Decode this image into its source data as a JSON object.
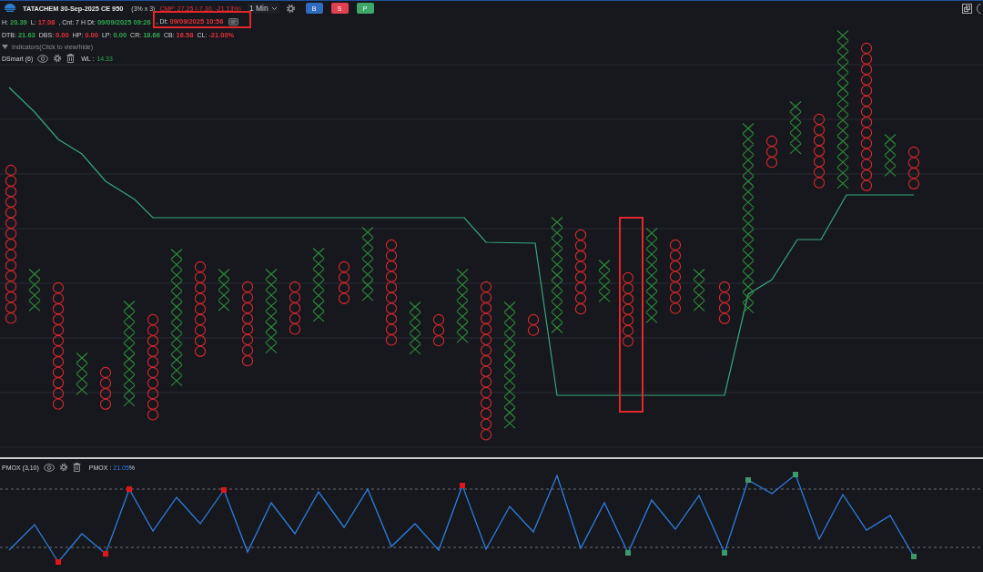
{
  "header": {
    "symbol": "TATACHEM 30-Sep-2025 CE 950",
    "box": "(3% x 3)",
    "cmp": "CMP: 27.25 (-7.30, -21.13%)",
    "interval": "1 Min",
    "buttons": [
      {
        "label": "B",
        "color": "#2f6bbf"
      },
      {
        "label": "S",
        "color": "#e0404f"
      },
      {
        "label": "P",
        "color": "#3fa66a"
      }
    ]
  },
  "stats": [
    [
      {
        "label": "H:",
        "value": "20.39",
        "color": "#2fa84f"
      },
      {
        "label": "L:",
        "value": "17.08",
        "color": "#e8303a"
      },
      {
        "label": ", Cnt: 7 H Dt:",
        "value": "09/09/2025 09:26",
        "color": "#2fa84f"
      },
      {
        "label": ", Dt:",
        "value": "09/09/2025 10:56",
        "color": "#e8303a"
      }
    ],
    [
      {
        "label": "DTB:",
        "value": "21.63",
        "color": "#2fa84f"
      },
      {
        "label": "DBS:",
        "value": "0.00",
        "color": "#e8303a"
      },
      {
        "label": "HP:",
        "value": "0.00",
        "color": "#e8303a"
      },
      {
        "label": "LP:",
        "value": "0.00",
        "color": "#2fa84f"
      },
      {
        "label": "CR:",
        "value": "18.66",
        "color": "#2fa84f"
      },
      {
        "label": "CB:",
        "value": "16.58",
        "color": "#e8303a"
      },
      {
        "label": "CL:",
        "value": "-21.00%",
        "color": "#e8303a"
      }
    ]
  ],
  "indicators_toggle": "Indicators(Click to view/hide)",
  "indicator": {
    "name": "DSmart (6)",
    "label": "WL :",
    "value": "14.33"
  },
  "oscillator": {
    "name": "PMOX (3,10)",
    "label": "PMOX :",
    "value": "21.05",
    "unit": "%"
  }
}
